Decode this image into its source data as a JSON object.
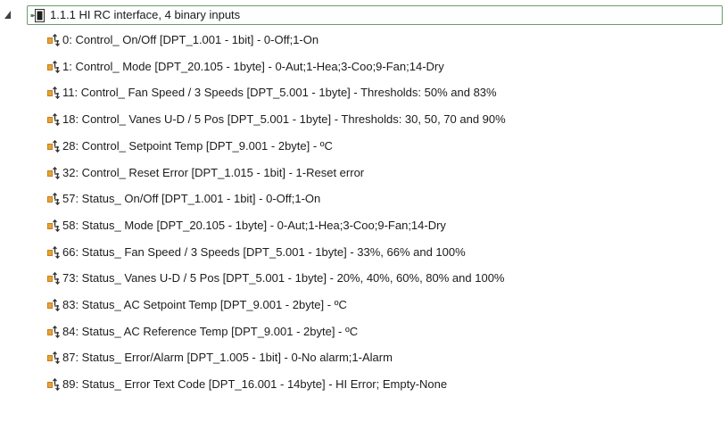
{
  "tree": {
    "root": {
      "label": "1.1.1  HI RC interface, 4 binary inputs",
      "expanded": true,
      "icon": "device-icon"
    },
    "objects": [
      {
        "label": "0: Control_ On/Off [DPT_1.001 - 1bit] - 0-Off;1-On",
        "icon": "comm-object-icon"
      },
      {
        "label": "1: Control_ Mode [DPT_20.105 - 1byte] - 0-Aut;1-Hea;3-Coo;9-Fan;14-Dry",
        "icon": "comm-object-icon"
      },
      {
        "label": "11: Control_ Fan Speed / 3 Speeds [DPT_5.001 - 1byte]  - Thresholds: 50% and 83%",
        "icon": "comm-object-icon"
      },
      {
        "label": "18: Control_ Vanes U-D / 5 Pos [DPT_5.001 - 1byte] - Thresholds: 30, 50, 70 and 90%",
        "icon": "comm-object-icon"
      },
      {
        "label": "28: Control_ Setpoint Temp [DPT_9.001 - 2byte] -  ºC",
        "icon": "comm-object-icon"
      },
      {
        "label": "32: Control_ Reset Error [DPT_1.015 - 1bit] - 1-Reset error",
        "icon": "comm-object-icon"
      },
      {
        "label": "57: Status_ On/Off [DPT_1.001 - 1bit] - 0-Off;1-On",
        "icon": "comm-object-icon"
      },
      {
        "label": "58: Status_ Mode [DPT_20.105 - 1byte] - 0-Aut;1-Hea;3-Coo;9-Fan;14-Dry",
        "icon": "comm-object-icon"
      },
      {
        "label": "66: Status_ Fan Speed / 3 Speeds [DPT_5.001 - 1byte]  - 33%, 66% and 100%",
        "icon": "comm-object-icon"
      },
      {
        "label": "73: Status_ Vanes U-D / 5 Pos [DPT_5.001 - 1byte] - 20%, 40%, 60%, 80% and 100%",
        "icon": "comm-object-icon"
      },
      {
        "label": "83: Status_ AC Setpoint Temp [DPT_9.001 - 2byte] - ºC",
        "icon": "comm-object-icon"
      },
      {
        "label": "84: Status_ AC Reference Temp [DPT_9.001 - 2byte] - ºC",
        "icon": "comm-object-icon"
      },
      {
        "label": "87: Status_ Error/Alarm [DPT_1.005 - 1bit] - 0-No alarm;1-Alarm",
        "icon": "comm-object-icon"
      },
      {
        "label": "89: Status_ Error Text Code [DPT_16.001 - 14byte] - HI Error; Empty-None",
        "icon": "comm-object-icon"
      }
    ]
  },
  "colors": {
    "selection_border": "#6c9c6e",
    "icon_orange": "#e8a23a",
    "icon_dark": "#3a3a3a"
  }
}
